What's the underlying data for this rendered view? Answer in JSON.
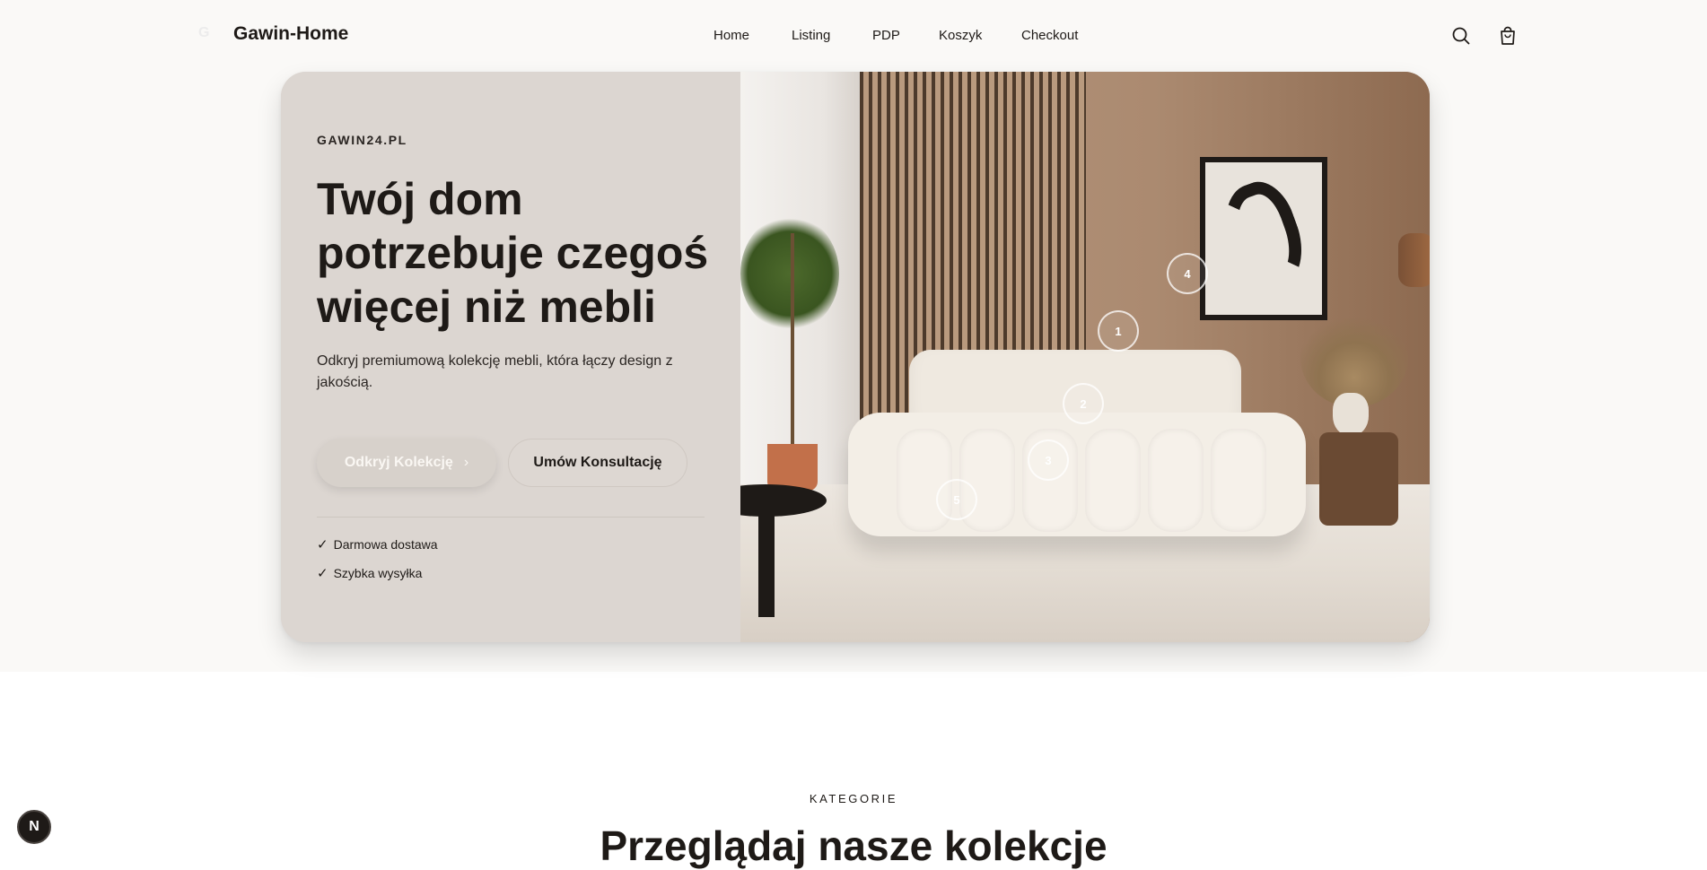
{
  "header": {
    "logo_mark": "G",
    "brand": "Gawin-Home",
    "nav": [
      "Home",
      "Listing",
      "PDP",
      "Koszyk",
      "Checkout"
    ],
    "icons": [
      "search-icon",
      "shopping-bag-icon"
    ]
  },
  "hero": {
    "eyebrow": "GAWIN24.PL",
    "headline": "Twój dom potrzebuje czegoś więcej niż mebli",
    "subtext": "Odkryj premiumową kolekcję mebli, która łączy design z jakością.",
    "primary_button": "Odkryj Kolekcję",
    "secondary_button": "Umów Konsultację",
    "perks": [
      "Darmowa dostawa",
      "Szybka wysyłka"
    ],
    "hotspots": [
      "1",
      "2",
      "3",
      "4",
      "5"
    ]
  },
  "categories": {
    "eyebrow": "KATEGORIE",
    "title": "Przeglądaj nasze kolekcje"
  },
  "dev_badge": "N",
  "colors": {
    "text": "#1e1a17",
    "hero_left_bg": "#dcd6d1",
    "page_bg": "#faf9f7"
  }
}
